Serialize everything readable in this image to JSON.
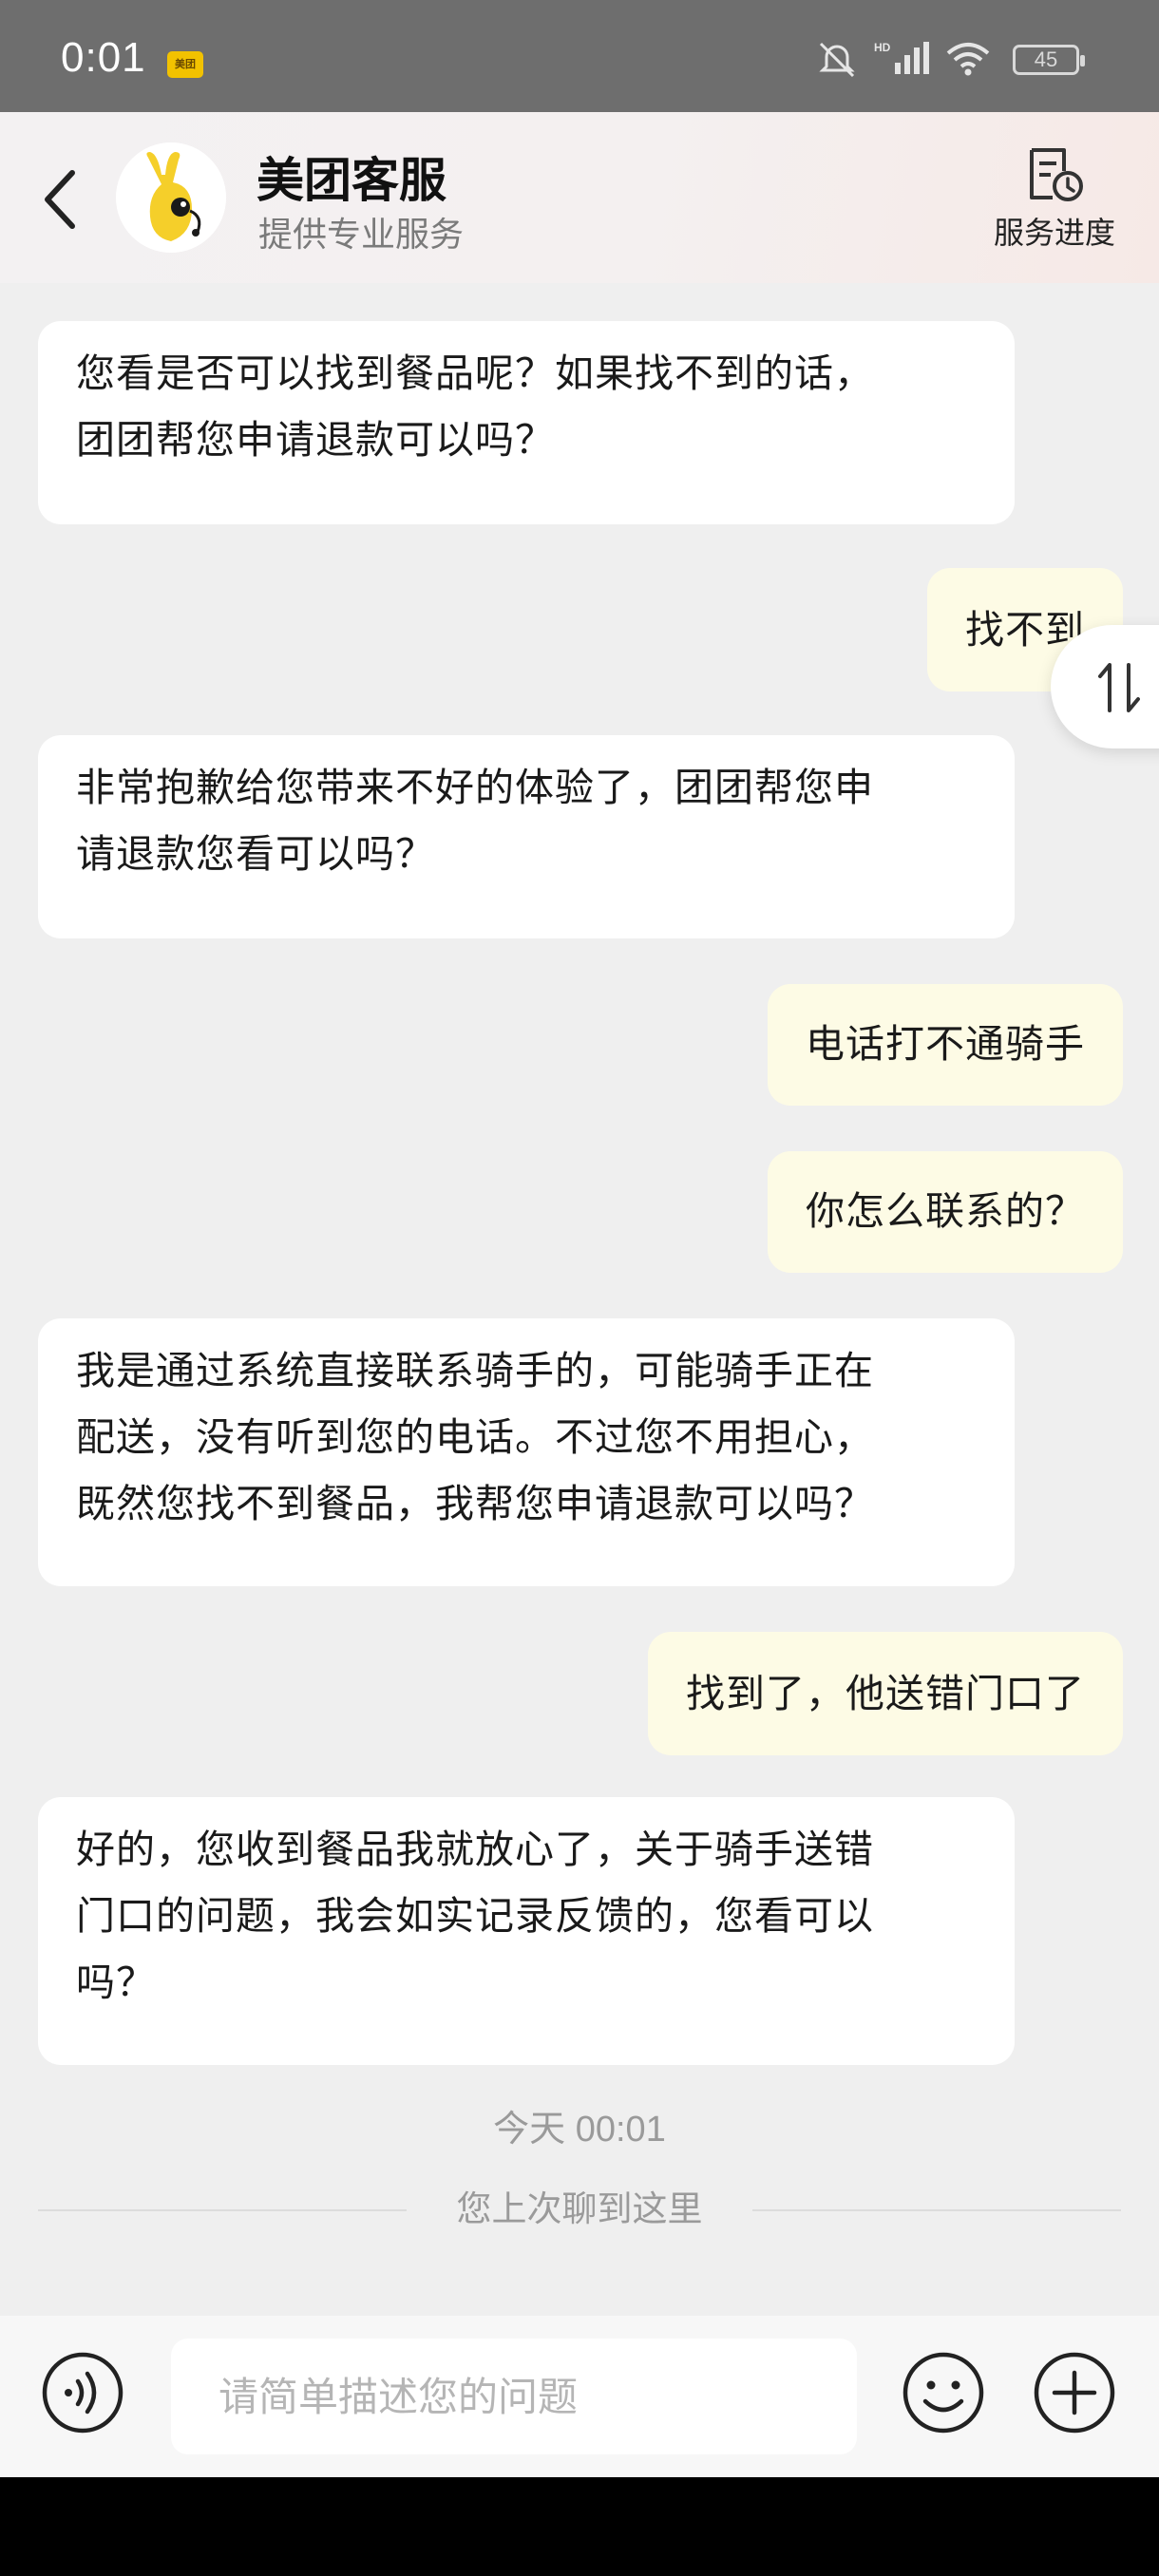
{
  "status_bar": {
    "time": "0:01",
    "app_icon_text": "美团",
    "battery": "45"
  },
  "header": {
    "title": "美团客服",
    "subtitle": "提供专业服务",
    "service_progress_label": "服务进度"
  },
  "messages": [
    {
      "sender": "agent",
      "lines": [
        "您看是否可以找到餐品呢？如果找不到的话，",
        "团团帮您申请退款可以吗？"
      ]
    },
    {
      "sender": "user",
      "text": "找不到"
    },
    {
      "sender": "agent",
      "lines": [
        "非常抱歉给您带来不好的体验了，团团帮您申",
        "请退款您看可以吗？"
      ]
    },
    {
      "sender": "user",
      "text": "电话打不通骑手"
    },
    {
      "sender": "user",
      "text": "你怎么联系的？"
    },
    {
      "sender": "agent",
      "lines": [
        "我是通过系统直接联系骑手的，可能骑手正在",
        "配送，没有听到您的电话。不过您不用担心，",
        "既然您找不到餐品，我帮您申请退款可以吗？"
      ]
    },
    {
      "sender": "user",
      "text": "找到了，他送错门口了"
    },
    {
      "sender": "agent",
      "lines": [
        "好的，您收到餐品我就放心了，关于骑手送错",
        "门口的问题，我会如实记录反馈的，您看可以",
        "吗？"
      ]
    }
  ],
  "timestamp": "今天 00:01",
  "history_divider": "您上次聊到这里",
  "input": {
    "placeholder": "请简单描述您的问题",
    "value": ""
  },
  "icons": {
    "back": "chevron-left-icon",
    "service_progress": "document-clock-icon",
    "float_toggle": "swap-vertical-icon",
    "voice": "voice-icon",
    "emoji": "smiley-icon",
    "plus": "plus-circle-icon"
  },
  "colors": {
    "agent_bubble": "#ffffff",
    "user_bubble": "#fdfbe5",
    "background": "#efefef",
    "status_bar": "#6e6e6e",
    "mascot_yellow": "#f5cf2a"
  }
}
